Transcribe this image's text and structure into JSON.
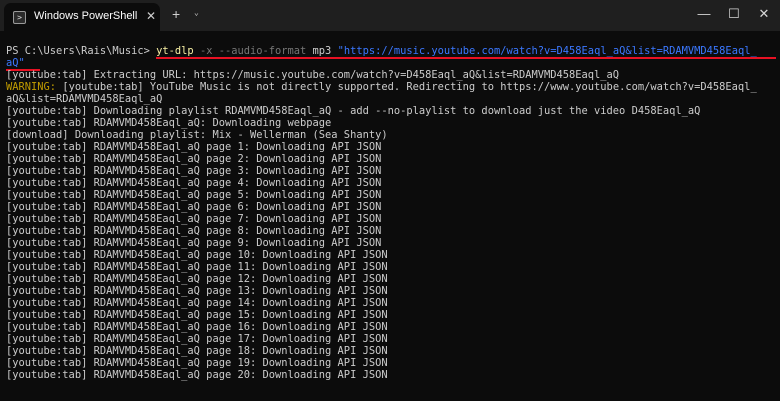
{
  "window": {
    "tab_title": "Windows PowerShell",
    "tab_icon": "powershell-icon",
    "tab_close": "✕",
    "new_tab": "+",
    "dropdown": "⌄",
    "minimize": "—",
    "maximize": "☐",
    "close": "✕"
  },
  "command": {
    "prompt": "PS C:\\Users\\Rais\\Music> ",
    "program": "yt-dlp",
    "flag1": " -x --audio-format ",
    "arg": "mp3",
    "url_line1": " \"https://music.youtube.com/watch?v=D458Eaql_aQ&list=RDAMVMD458Eaql_",
    "url_line2": "aQ\""
  },
  "output": {
    "extract": "[youtube:tab] Extracting URL: https://music.youtube.com/watch?v=D458Eaql_aQ&list=RDAMVMD458Eaql_aQ",
    "warning_prefix": "WARNING: ",
    "warning_text1": "[youtube:tab] YouTube Music is not directly supported. Redirecting to https://www.youtube.com/watch?v=D458Eaql_",
    "warning_text2": "aQ&list=RDAMVMD458Eaql_aQ",
    "lines": [
      "[youtube:tab] Downloading playlist RDAMVMD458Eaql_aQ - add --no-playlist to download just the video D458Eaql_aQ",
      "[youtube:tab] RDAMVMD458Eaql_aQ: Downloading webpage",
      "[download] Downloading playlist: Mix - Wellerman (Sea Shanty)",
      "[youtube:tab] RDAMVMD458Eaql_aQ page 1: Downloading API JSON",
      "[youtube:tab] RDAMVMD458Eaql_aQ page 2: Downloading API JSON",
      "[youtube:tab] RDAMVMD458Eaql_aQ page 3: Downloading API JSON",
      "[youtube:tab] RDAMVMD458Eaql_aQ page 4: Downloading API JSON",
      "[youtube:tab] RDAMVMD458Eaql_aQ page 5: Downloading API JSON",
      "[youtube:tab] RDAMVMD458Eaql_aQ page 6: Downloading API JSON",
      "[youtube:tab] RDAMVMD458Eaql_aQ page 7: Downloading API JSON",
      "[youtube:tab] RDAMVMD458Eaql_aQ page 8: Downloading API JSON",
      "[youtube:tab] RDAMVMD458Eaql_aQ page 9: Downloading API JSON",
      "[youtube:tab] RDAMVMD458Eaql_aQ page 10: Downloading API JSON",
      "[youtube:tab] RDAMVMD458Eaql_aQ page 11: Downloading API JSON",
      "[youtube:tab] RDAMVMD458Eaql_aQ page 12: Downloading API JSON",
      "[youtube:tab] RDAMVMD458Eaql_aQ page 13: Downloading API JSON",
      "[youtube:tab] RDAMVMD458Eaql_aQ page 14: Downloading API JSON",
      "[youtube:tab] RDAMVMD458Eaql_aQ page 15: Downloading API JSON",
      "[youtube:tab] RDAMVMD458Eaql_aQ page 16: Downloading API JSON",
      "[youtube:tab] RDAMVMD458Eaql_aQ page 17: Downloading API JSON",
      "[youtube:tab] RDAMVMD458Eaql_aQ page 18: Downloading API JSON",
      "[youtube:tab] RDAMVMD458Eaql_aQ page 19: Downloading API JSON",
      "[youtube:tab] RDAMVMD458Eaql_aQ page 20: Downloading API JSON"
    ]
  },
  "colors": {
    "background": "#0c0c0c",
    "titlebar": "#1f1f1f",
    "text": "#cccccc",
    "command": "#f9f1a5",
    "flag": "#767676",
    "url": "#3b78ff",
    "warning": "#c19c00",
    "highlight_underline": "#e81123"
  }
}
